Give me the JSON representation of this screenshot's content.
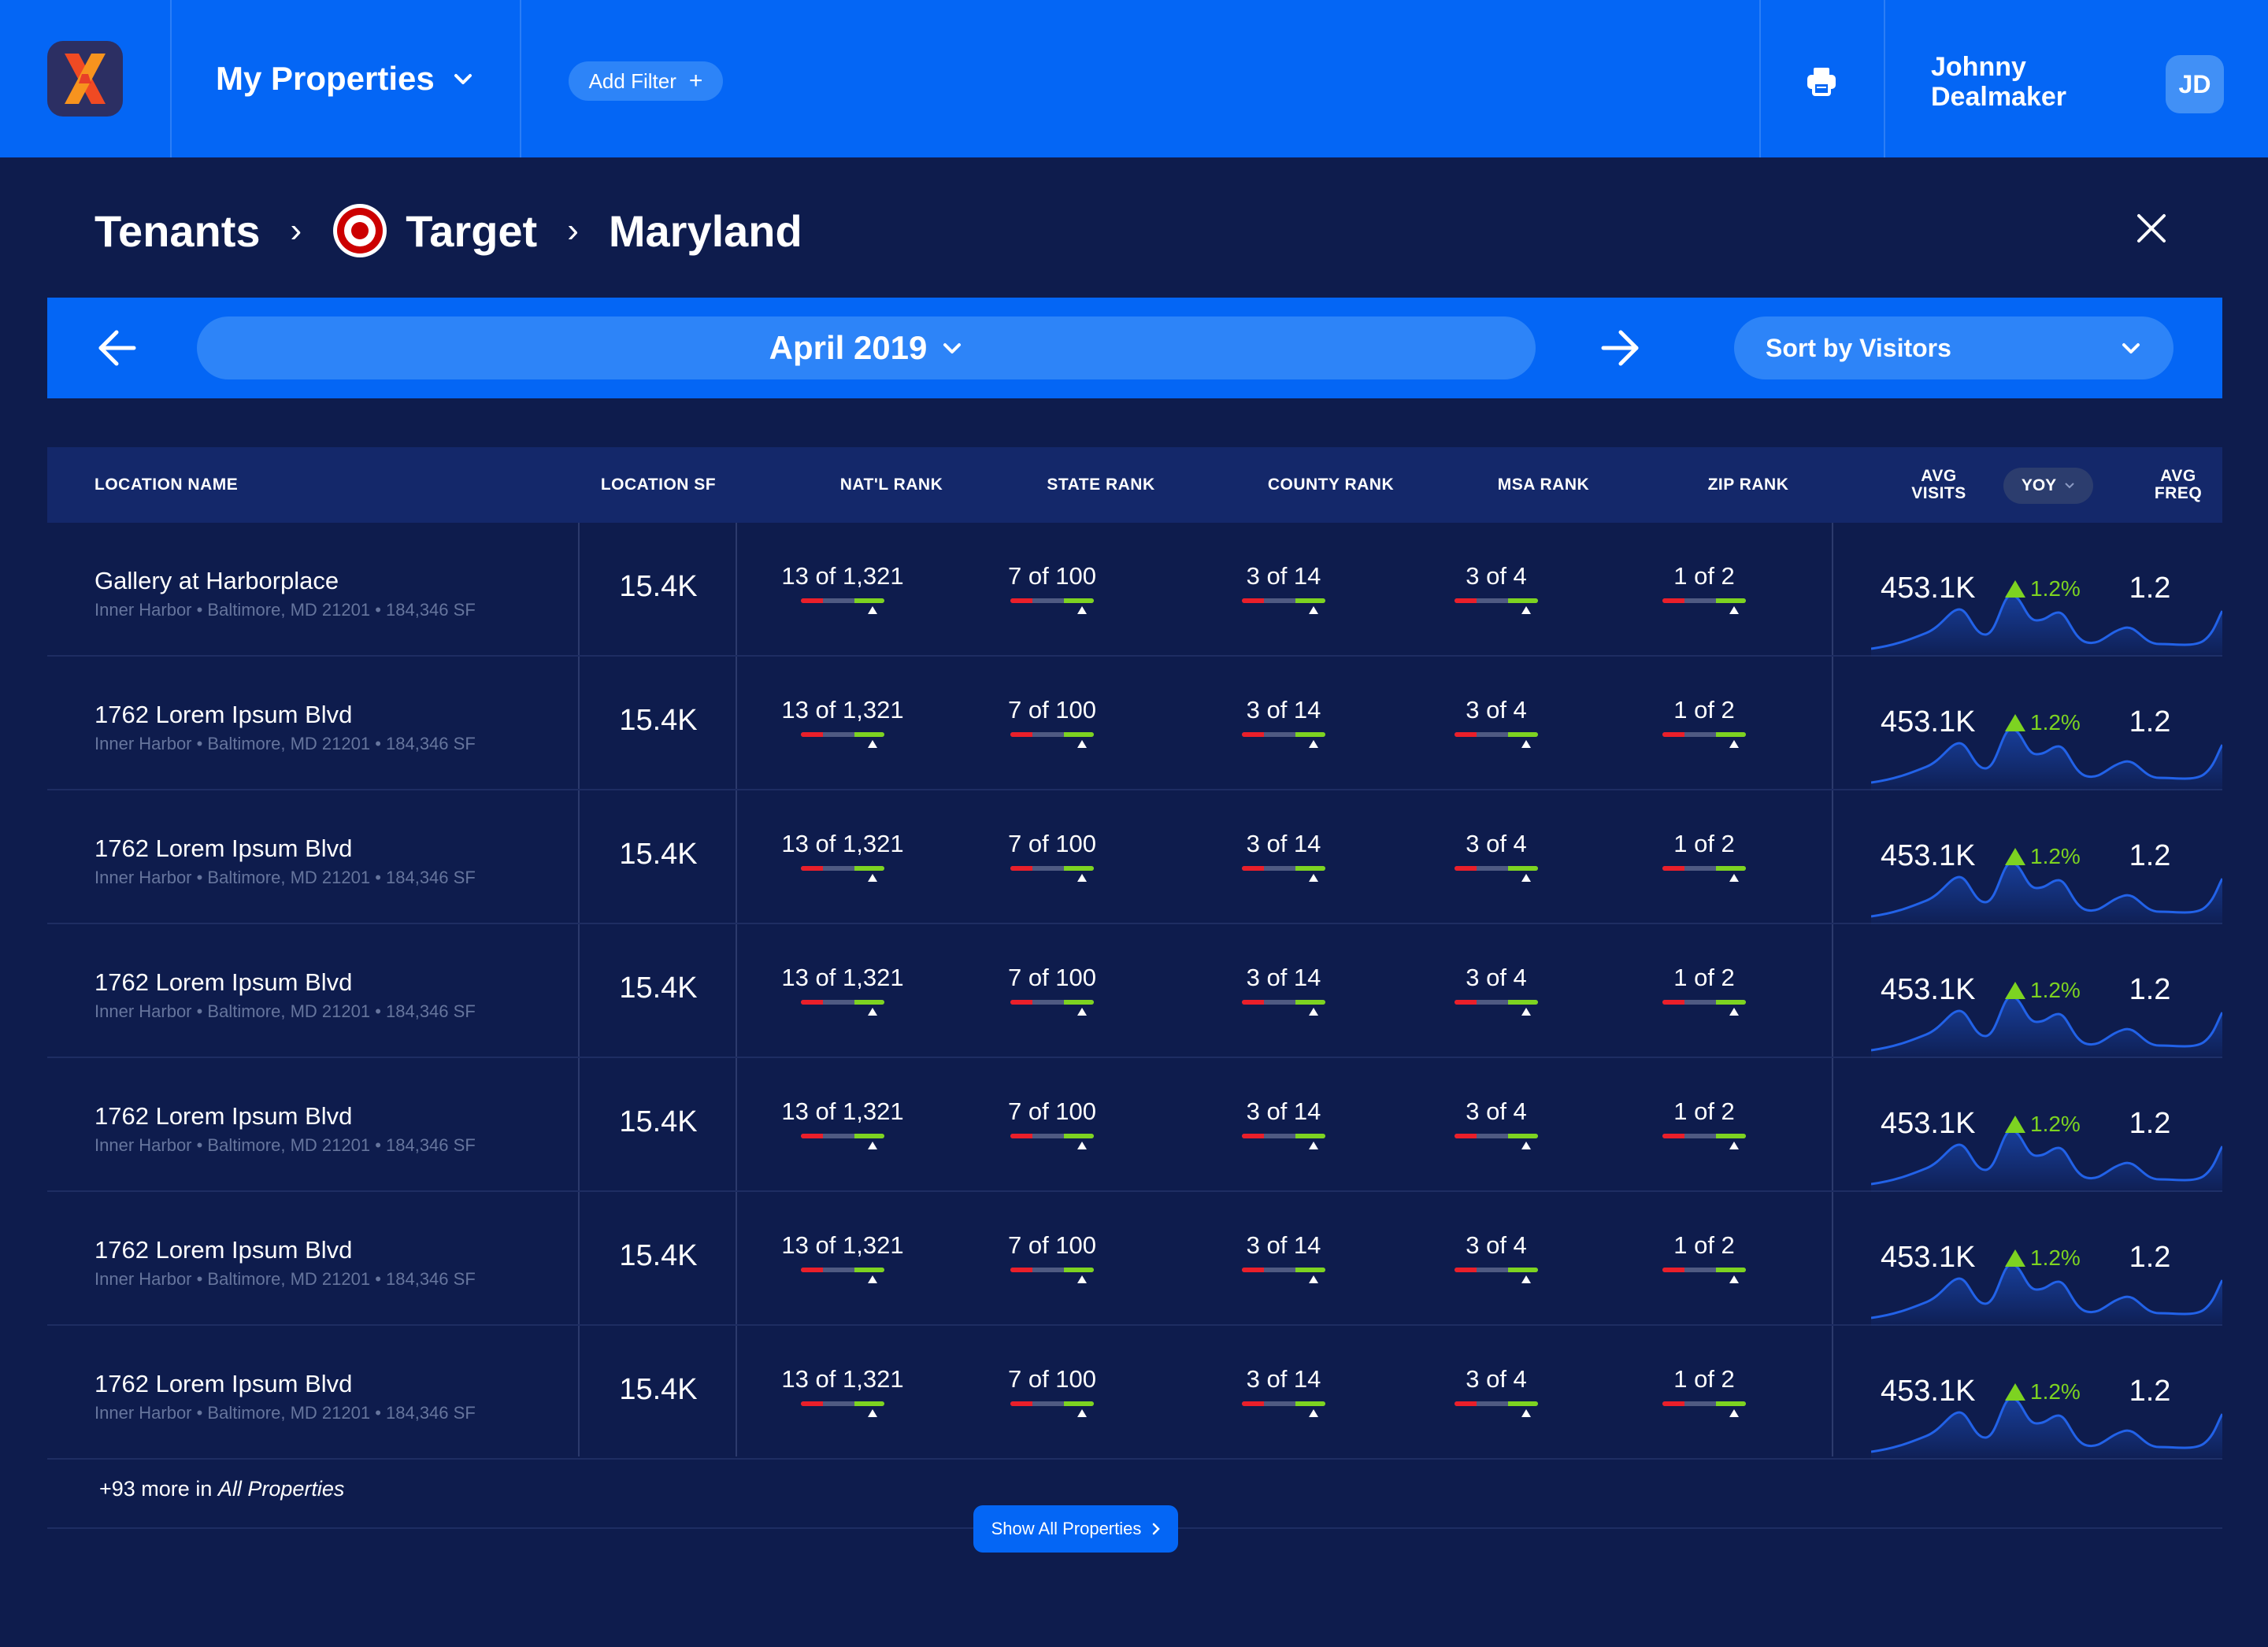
{
  "app": {
    "title": "My Properties",
    "add_filter_label": "Add Filter"
  },
  "user": {
    "name": "Johnny Dealmaker",
    "initials": "JD"
  },
  "breadcrumb": {
    "root": "Tenants",
    "tenant": "Target",
    "state": "Maryland"
  },
  "period": {
    "month_label": "April 2019",
    "sort_label": "Sort by Visitors"
  },
  "columns": {
    "location_name": "LOCATION NAME",
    "location_sf": "LOCATION SF",
    "natl_rank": "NAT'L RANK",
    "state_rank": "STATE RANK",
    "county_rank": "COUNTY RANK",
    "msa_rank": "MSA RANK",
    "zip_rank": "ZIP RANK",
    "avg_visits": "AVG VISITS",
    "yoy": "YOY",
    "avg_freq": "AVG FREQ"
  },
  "rows": [
    {
      "name": "Gallery at Harborplace",
      "sub": "Inner Harbor • Baltimore, MD 21201 • 184,346 SF",
      "sf": "15.4K",
      "natl": "13 of 1,321",
      "state": "7 of 100",
      "county": "3 of 14",
      "msa": "3 of 4",
      "zip": "1 of 2",
      "visits": "453.1K",
      "yoy": "1.2%",
      "freq": "1.2"
    },
    {
      "name": "1762 Lorem Ipsum Blvd",
      "sub": "Inner Harbor • Baltimore, MD 21201 • 184,346 SF",
      "sf": "15.4K",
      "natl": "13 of 1,321",
      "state": "7 of 100",
      "county": "3 of 14",
      "msa": "3 of 4",
      "zip": "1 of 2",
      "visits": "453.1K",
      "yoy": "1.2%",
      "freq": "1.2"
    },
    {
      "name": "1762 Lorem Ipsum Blvd",
      "sub": "Inner Harbor • Baltimore, MD 21201 • 184,346 SF",
      "sf": "15.4K",
      "natl": "13 of 1,321",
      "state": "7 of 100",
      "county": "3 of 14",
      "msa": "3 of 4",
      "zip": "1 of 2",
      "visits": "453.1K",
      "yoy": "1.2%",
      "freq": "1.2"
    },
    {
      "name": "1762 Lorem Ipsum Blvd",
      "sub": "Inner Harbor • Baltimore, MD 21201 • 184,346 SF",
      "sf": "15.4K",
      "natl": "13 of 1,321",
      "state": "7 of 100",
      "county": "3 of 14",
      "msa": "3 of 4",
      "zip": "1 of 2",
      "visits": "453.1K",
      "yoy": "1.2%",
      "freq": "1.2"
    },
    {
      "name": "1762 Lorem Ipsum Blvd",
      "sub": "Inner Harbor • Baltimore, MD 21201 • 184,346 SF",
      "sf": "15.4K",
      "natl": "13 of 1,321",
      "state": "7 of 100",
      "county": "3 of 14",
      "msa": "3 of 4",
      "zip": "1 of 2",
      "visits": "453.1K",
      "yoy": "1.2%",
      "freq": "1.2"
    },
    {
      "name": "1762 Lorem Ipsum Blvd",
      "sub": "Inner Harbor • Baltimore, MD 21201 • 184,346 SF",
      "sf": "15.4K",
      "natl": "13 of 1,321",
      "state": "7 of 100",
      "county": "3 of 14",
      "msa": "3 of 4",
      "zip": "1 of 2",
      "visits": "453.1K",
      "yoy": "1.2%",
      "freq": "1.2"
    },
    {
      "name": "1762 Lorem Ipsum Blvd",
      "sub": "Inner Harbor • Baltimore, MD 21201 • 184,346 SF",
      "sf": "15.4K",
      "natl": "13 of 1,321",
      "state": "7 of 100",
      "county": "3 of 14",
      "msa": "3 of 4",
      "zip": "1 of 2",
      "visits": "453.1K",
      "yoy": "1.2%",
      "freq": "1.2"
    }
  ],
  "footer": {
    "more_prefix": "+93 more in ",
    "more_link": "All Properties",
    "show_all_label": "Show All Properties"
  },
  "colors": {
    "topbar": "#0466f5",
    "background": "#0e1c4d",
    "header_row": "#14286a",
    "positive": "#7dd321",
    "negative": "#ea1f2a",
    "pill": "#2d84f8"
  },
  "icons": [
    "chevron-down-icon",
    "plus-icon",
    "printer-icon",
    "target-logo",
    "close-icon",
    "arrow-left-icon",
    "arrow-right-icon",
    "triangle-up-icon",
    "chevron-right-icon"
  ]
}
